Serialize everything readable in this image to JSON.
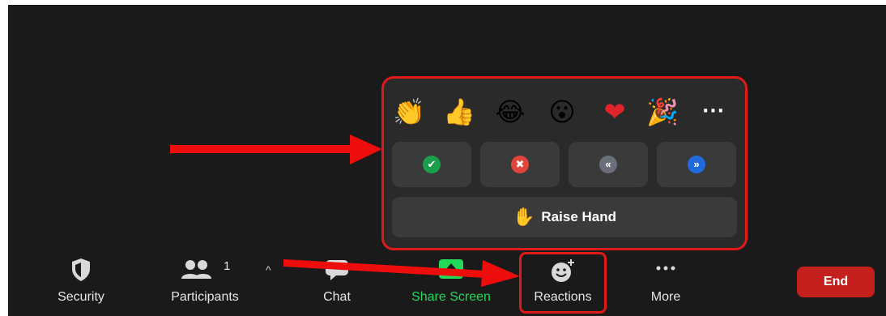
{
  "popup": {
    "emojis": [
      {
        "name": "clap-emoji",
        "glyph": "👏"
      },
      {
        "name": "thumbs-up-emoji",
        "glyph": "👍"
      },
      {
        "name": "joy-emoji",
        "glyph": "😂"
      },
      {
        "name": "open-mouth-emoji",
        "glyph": "😮"
      },
      {
        "name": "heart-emoji",
        "glyph": "❤"
      },
      {
        "name": "party-popper-emoji",
        "glyph": "🎉"
      }
    ],
    "more_glyph": "···",
    "feedback": [
      {
        "name": "yes",
        "glyph": "✔",
        "color": "#1aa04c"
      },
      {
        "name": "no",
        "glyph": "✖",
        "color": "#e0443a"
      },
      {
        "name": "slow-down",
        "glyph": "«",
        "color": "#6b6f7a"
      },
      {
        "name": "speed-up",
        "glyph": "»",
        "color": "#1f6bdc"
      }
    ],
    "raise_hand_glyph": "✋",
    "raise_hand_label": "Raise Hand"
  },
  "toolbar": {
    "security_label": "Security",
    "participants_label": "Participants",
    "participants_count": "1",
    "chat_label": "Chat",
    "share_label": "Share Screen",
    "reactions_label": "Reactions",
    "more_label": "More",
    "end_label": "End",
    "share_color": "#23d959",
    "end_color": "#c4201e"
  },
  "colors": {
    "background": "#1a1a1a",
    "popup": "#2a2a2a",
    "tile": "#3a3a3a",
    "highlight": "#e01919"
  }
}
